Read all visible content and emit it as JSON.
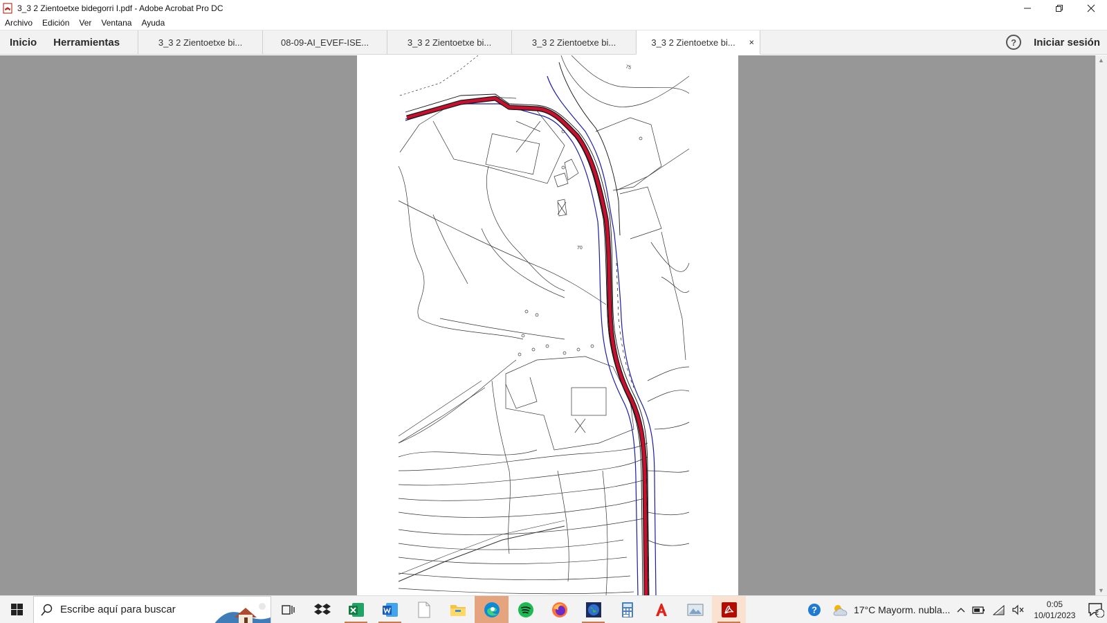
{
  "window": {
    "title": "3_3 2 Zientoetxe bidegorri I.pdf - Adobe Acrobat Pro DC"
  },
  "menu": {
    "items": [
      "Archivo",
      "Edición",
      "Ver",
      "Ventana",
      "Ayuda"
    ]
  },
  "tabs": {
    "home": "Inicio",
    "tools": "Herramientas",
    "documents": [
      "3_3 2 Zientoetxe bi...",
      "08-09-AI_EVEF-ISE...",
      "3_3 2 Zientoetxe bi...",
      "3_3 2 Zientoetxe bi...",
      "3_3 2 Zientoetxe bi..."
    ],
    "close_symbol": "×",
    "help_symbol": "?",
    "sign_in": "Iniciar sesión"
  },
  "map": {
    "contour_labels": [
      "75",
      "70"
    ],
    "route_color": "#c8102e",
    "border_color": "#1a1aa8"
  },
  "taskbar": {
    "search_placeholder": "Escribe aquí para buscar",
    "weather": "17°C  Mayorm. nubla...",
    "time": "0:05",
    "date": "10/01/2023",
    "notification_count": "2",
    "apps": [
      "task-view",
      "dropbox",
      "excel",
      "word",
      "notepad",
      "file-explorer",
      "edge",
      "spotify",
      "firefox",
      "globe",
      "calculator",
      "acrobat-reader",
      "photo-viewer",
      "acrobat-pro"
    ]
  }
}
